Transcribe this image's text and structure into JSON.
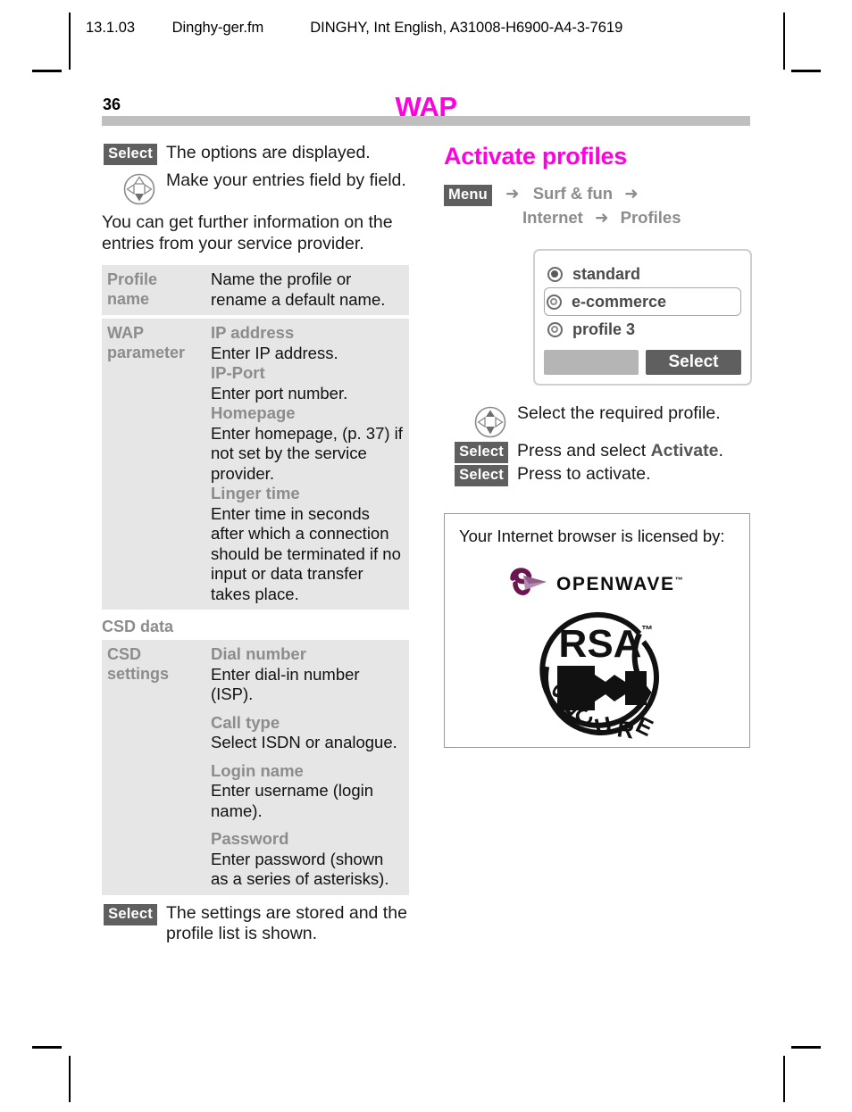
{
  "running_header": {
    "date": "13.1.03",
    "filename": "Dinghy-ger.fm",
    "reference": "DINGHY, Int English, A31008-H6900-A4-3-7619"
  },
  "page": {
    "number": "36",
    "chapter_title": "WAP"
  },
  "colors": {
    "accent_magenta": "#ff00e0",
    "softkey_bg": "#5f5f5f",
    "table_bg": "#e6e6e6",
    "label_gray": "#8c8c8c",
    "rule_gray": "#bfbfbf"
  },
  "left_column": {
    "steps_top": [
      {
        "key_label": "Select",
        "key_type": "softkey",
        "text": "The options are displayed."
      },
      {
        "key_label": "navigation-pad",
        "key_type": "navpad",
        "text": "Make your entries field by field."
      }
    ],
    "paragraph": "You can get further information on the entries from your service provider.",
    "wap_table": [
      {
        "label": "Profile name",
        "entries": [
          {
            "title": "",
            "desc": "Name the profile or rename a default name."
          }
        ]
      },
      {
        "label": "WAP parameter",
        "entries": [
          {
            "title": "IP address",
            "desc": "Enter IP address."
          },
          {
            "title": "IP-Port",
            "desc": "Enter port number."
          },
          {
            "title": "Homepage",
            "desc": "Enter homepage, (p. 37) if not set by the service provider."
          },
          {
            "title": "Linger time",
            "desc": "Enter time in seconds after which a connection should be terminated if no input or data transfer takes place."
          }
        ]
      }
    ],
    "csd_heading": "CSD data",
    "csd_table": [
      {
        "label": "CSD settings",
        "entries": [
          {
            "title": "Dial number",
            "desc": "Enter dial-in number (ISP)."
          },
          {
            "title": "Call type",
            "desc": "Select ISDN or analogue."
          },
          {
            "title": "Login name",
            "desc": "Enter username (login name)."
          },
          {
            "title": "Password",
            "desc": "Enter password (shown as a series of asterisks)."
          }
        ]
      }
    ],
    "steps_bottom": [
      {
        "key_label": "Select",
        "key_type": "softkey",
        "text": "The settings are stored and the profile list is shown."
      }
    ]
  },
  "right_column": {
    "section_title": "Activate profiles",
    "menu_path": {
      "softkey": "Menu",
      "arrow": "➜",
      "items": [
        "Surf & fun",
        "Internet",
        "Profiles"
      ]
    },
    "phone": {
      "options": [
        {
          "label": "standard",
          "selected": true,
          "highlighted": false
        },
        {
          "label": "e-commerce",
          "selected": false,
          "highlighted": true
        },
        {
          "label": "profile 3",
          "selected": false,
          "highlighted": false
        }
      ],
      "left_softkey": "",
      "right_softkey": "Select"
    },
    "steps": [
      {
        "key_label": "navigation-pad",
        "key_type": "navpad",
        "text": "Select the required profile.",
        "emphasis": ""
      },
      {
        "key_label": "Select",
        "key_type": "softkey",
        "text_before": "Press and select ",
        "emphasis": "Activate",
        "text_after": "."
      },
      {
        "key_label": "Select",
        "key_type": "softkey",
        "text_before": "Press to activate.",
        "emphasis": "",
        "text_after": ""
      }
    ],
    "license_box": {
      "text": "Your Internet browser is licensed by:",
      "logos": [
        {
          "name": "openwave-logo",
          "wordmark": "OPENWAVE",
          "tm": "™"
        },
        {
          "name": "rsa-secure-logo",
          "top_text": "RSA",
          "tm": "™",
          "arc_text": "SECURE"
        }
      ]
    }
  }
}
